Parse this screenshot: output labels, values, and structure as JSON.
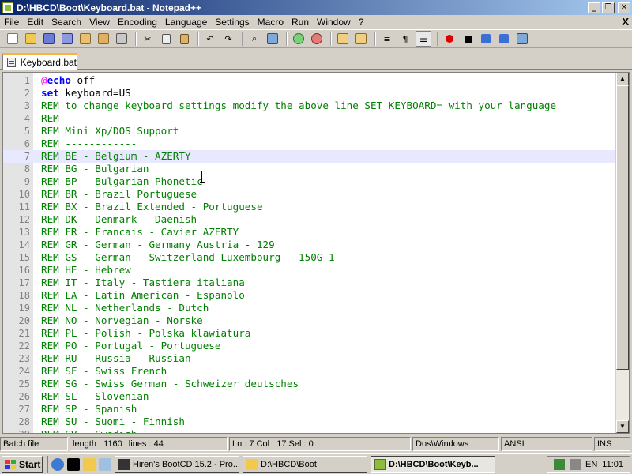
{
  "window": {
    "title": "D:\\HBCD\\Boot\\Keyboard.bat - Notepad++",
    "minimize_glyph": "_",
    "restore_glyph": "❐",
    "close_glyph": "✕"
  },
  "menu": {
    "items": [
      "File",
      "Edit",
      "Search",
      "View",
      "Encoding",
      "Language",
      "Settings",
      "Macro",
      "Run",
      "Window",
      "?"
    ],
    "doc_close": "X"
  },
  "toolbar": {
    "icons": [
      "new-file-icon",
      "open-file-icon",
      "save-icon",
      "save-all-icon",
      "close-icon",
      "close-all-icon",
      "print-icon",
      "cut-icon",
      "copy-icon",
      "paste-icon",
      "undo-icon",
      "redo-icon",
      "find-icon",
      "replace-icon",
      "zoom-in-icon",
      "zoom-out-icon",
      "sync-v-icon",
      "sync-h-icon",
      "wrap-icon",
      "show-all-chars-icon",
      "indent-guide-icon",
      "record-macro-icon",
      "stop-record-icon",
      "play-macro-icon",
      "run-macro-multiple-icon",
      "save-macro-icon"
    ]
  },
  "tabs": [
    {
      "label": "Keyboard.bat"
    }
  ],
  "editor": {
    "current_line": 7,
    "lines": [
      {
        "n": "1",
        "parts": [
          {
            "t": "@",
            "c": "at"
          },
          {
            "t": "echo",
            "c": "kw"
          },
          {
            "t": " off",
            "c": "plain"
          }
        ]
      },
      {
        "n": "2",
        "parts": [
          {
            "t": "set",
            "c": "kw"
          },
          {
            "t": " keyboard=US",
            "c": "plain"
          }
        ]
      },
      {
        "n": "3",
        "parts": [
          {
            "t": "REM to change keyboard settings modify the above line SET KEYBOARD= with your language",
            "c": "rem"
          }
        ]
      },
      {
        "n": "4",
        "parts": [
          {
            "t": "REM ------------",
            "c": "rem"
          }
        ]
      },
      {
        "n": "5",
        "parts": [
          {
            "t": "REM Mini Xp/DOS Support",
            "c": "rem"
          }
        ]
      },
      {
        "n": "6",
        "parts": [
          {
            "t": "REM ------------",
            "c": "rem"
          }
        ]
      },
      {
        "n": "7",
        "parts": [
          {
            "t": "REM BE - Belgium - AZERTY",
            "c": "rem"
          }
        ]
      },
      {
        "n": "8",
        "parts": [
          {
            "t": "REM BG - Bulgarian",
            "c": "rem"
          }
        ]
      },
      {
        "n": "9",
        "parts": [
          {
            "t": "REM BP - Bulgarian Phonetic",
            "c": "rem"
          }
        ]
      },
      {
        "n": "10",
        "parts": [
          {
            "t": "REM BR - Brazil Portuguese",
            "c": "rem"
          }
        ]
      },
      {
        "n": "11",
        "parts": [
          {
            "t": "REM BX - Brazil Extended - Portuguese",
            "c": "rem"
          }
        ]
      },
      {
        "n": "12",
        "parts": [
          {
            "t": "REM DK - Denmark - Daenish",
            "c": "rem"
          }
        ]
      },
      {
        "n": "13",
        "parts": [
          {
            "t": "REM FR - Francais - Cavier AZERTY",
            "c": "rem"
          }
        ]
      },
      {
        "n": "14",
        "parts": [
          {
            "t": "REM GR - German - Germany Austria - 129",
            "c": "rem"
          }
        ]
      },
      {
        "n": "15",
        "parts": [
          {
            "t": "REM GS - German - Switzerland Luxembourg - 150G-1",
            "c": "rem"
          }
        ]
      },
      {
        "n": "16",
        "parts": [
          {
            "t": "REM HE - Hebrew",
            "c": "rem"
          }
        ]
      },
      {
        "n": "17",
        "parts": [
          {
            "t": "REM IT - Italy - Tastiera italiana",
            "c": "rem"
          }
        ]
      },
      {
        "n": "18",
        "parts": [
          {
            "t": "REM LA - Latin American - Espanolo",
            "c": "rem"
          }
        ]
      },
      {
        "n": "19",
        "parts": [
          {
            "t": "REM NL - Netherlands - Dutch",
            "c": "rem"
          }
        ]
      },
      {
        "n": "20",
        "parts": [
          {
            "t": "REM NO - Norvegian - Norske",
            "c": "rem"
          }
        ]
      },
      {
        "n": "21",
        "parts": [
          {
            "t": "REM PL - Polish - Polska klawiatura",
            "c": "rem"
          }
        ]
      },
      {
        "n": "22",
        "parts": [
          {
            "t": "REM PO - Portugal - Portuguese",
            "c": "rem"
          }
        ]
      },
      {
        "n": "23",
        "parts": [
          {
            "t": "REM RU - Russia - Russian",
            "c": "rem"
          }
        ]
      },
      {
        "n": "24",
        "parts": [
          {
            "t": "REM SF - Swiss French",
            "c": "rem"
          }
        ]
      },
      {
        "n": "25",
        "parts": [
          {
            "t": "REM SG - Swiss German - Schweizer deutsches",
            "c": "rem"
          }
        ]
      },
      {
        "n": "26",
        "parts": [
          {
            "t": "REM SL - Slovenian",
            "c": "rem"
          }
        ]
      },
      {
        "n": "27",
        "parts": [
          {
            "t": "REM SP - Spanish",
            "c": "rem"
          }
        ]
      },
      {
        "n": "28",
        "parts": [
          {
            "t": "REM SU - Suomi - Finnish",
            "c": "rem"
          }
        ]
      },
      {
        "n": "29",
        "parts": [
          {
            "t": "REM SV - Swedish",
            "c": "rem"
          }
        ]
      }
    ]
  },
  "statusbar": {
    "file_type": "Batch file",
    "length": "length : 1160",
    "lines": "lines : 44",
    "position": "Ln : 7    Col : 17    Sel : 0",
    "eol": "Dos\\Windows",
    "encoding": "ANSI",
    "mode": "INS"
  },
  "taskbar": {
    "start_label": "Start",
    "tasks": [
      {
        "label": "Hiren's BootCD 15.2 - Pro...",
        "active": false
      },
      {
        "label": "D:\\HBCD\\Boot",
        "active": false
      },
      {
        "label": "D:\\HBCD\\Boot\\Keyb...",
        "active": true
      }
    ],
    "language": "EN",
    "clock": "11:01"
  },
  "colors": {
    "keyword": "#0000ff",
    "at_sign": "#ff00ff",
    "comment": "#008000",
    "current_line": "#e8e8ff",
    "tab_accent": "#fbb040"
  }
}
